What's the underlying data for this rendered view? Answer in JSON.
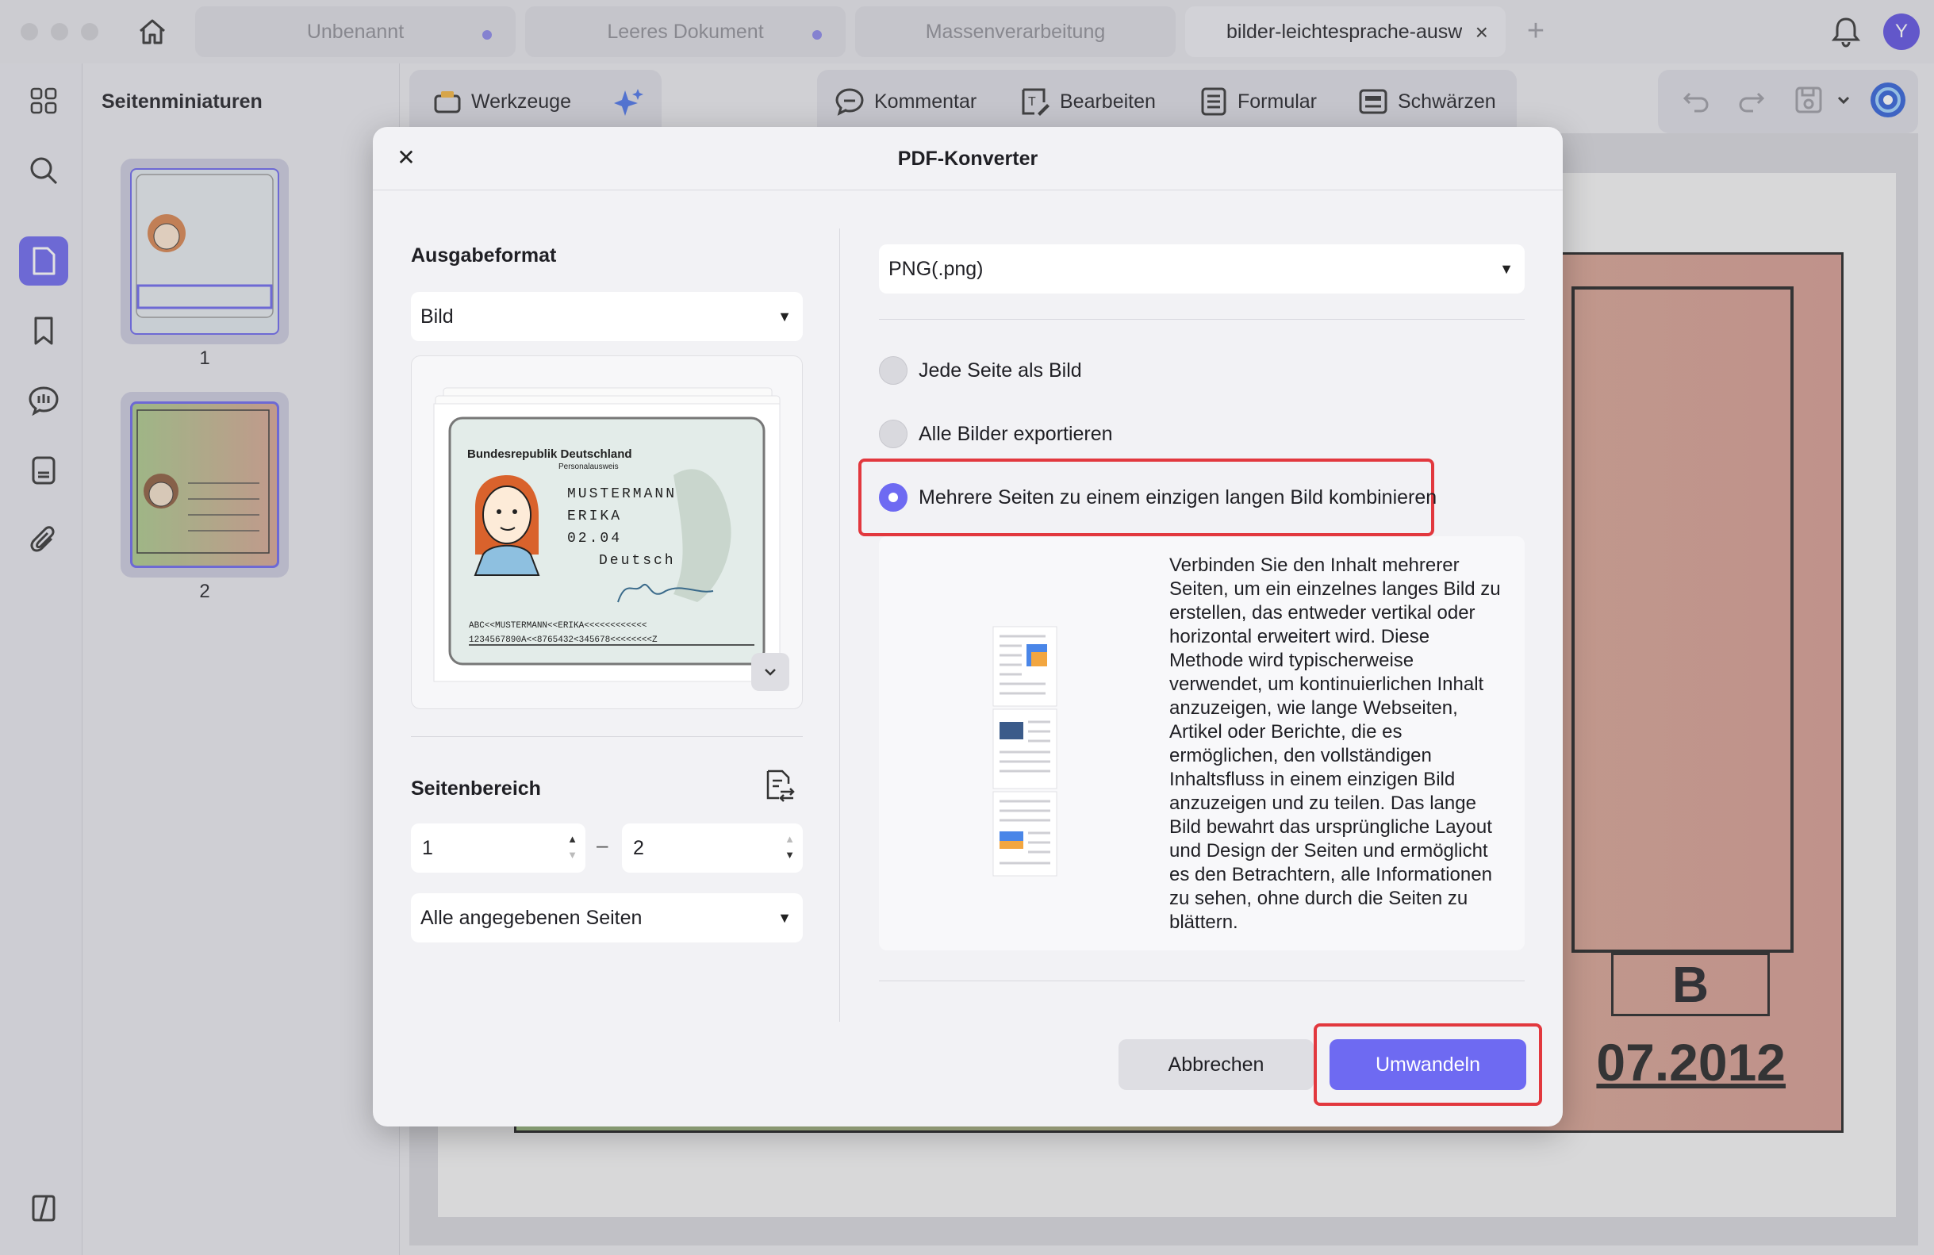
{
  "tabs": [
    {
      "label": "Unbenannt",
      "modified": true
    },
    {
      "label": "Leeres Dokument",
      "modified": true
    },
    {
      "label": "Massenverarbeitung",
      "modified": false
    },
    {
      "label": "bilder-leichtesprache-ausw",
      "active": true
    }
  ],
  "user": {
    "initial": "Y"
  },
  "thumbnails": {
    "title": "Seitenminiaturen",
    "pages": [
      "1",
      "2"
    ]
  },
  "toolbar": {
    "tools": "Werkzeuge",
    "comment": "Kommentar",
    "edit": "Bearbeiten",
    "form": "Formular",
    "redact": "Schwärzen"
  },
  "document": {
    "bottom_cell": "B",
    "date": "07.2012"
  },
  "dialog": {
    "title": "PDF-Konverter",
    "output_format_label": "Ausgabeformat",
    "output_format_value": "Bild",
    "image_format_value": "PNG(.png)",
    "preview_card": {
      "header": "Bundesrepublik Deutschland",
      "subheader": "Personalausweis",
      "lines": [
        "MUSTERMANN",
        "ERIKA",
        "02.04",
        "Deutsch"
      ],
      "mrz1": "ABC<<MUSTERMANN<<ERIKA<<<<<<<<<<<<",
      "mrz2": "1234567890A<<8765432<345678<<<<<<<<Z"
    },
    "page_range_label": "Seitenbereich",
    "range_from": "1",
    "range_to": "2",
    "page_subset": "Alle angegebenen Seiten",
    "options": [
      {
        "label": "Jede Seite als Bild",
        "checked": false
      },
      {
        "label": "Alle Bilder exportieren",
        "checked": false
      },
      {
        "label": "Mehrere Seiten zu einem einzigen langen Bild kombinieren",
        "checked": true
      }
    ],
    "description": "Verbinden Sie den Inhalt mehrerer Seiten, um ein einzelnes langes Bild zu erstellen, das entweder vertikal oder horizontal erweitert wird. Diese Methode wird typischerweise verwendet, um kontinuierlichen Inhalt anzuzeigen, wie lange Webseiten, Artikel oder Berichte, die es ermöglichen, den vollständigen Inhaltsfluss in einem einzigen Bild anzuzeigen und zu teilen. Das lange Bild bewahrt das ursprüngliche Layout und Design der Seiten und ermöglicht es den Betrachtern, alle Informationen zu sehen, ohne durch die Seiten zu blättern.",
    "cancel_label": "Abbrechen",
    "convert_label": "Umwandeln"
  },
  "colors": {
    "accent": "#6e6af2",
    "highlight": "#e2383e"
  }
}
